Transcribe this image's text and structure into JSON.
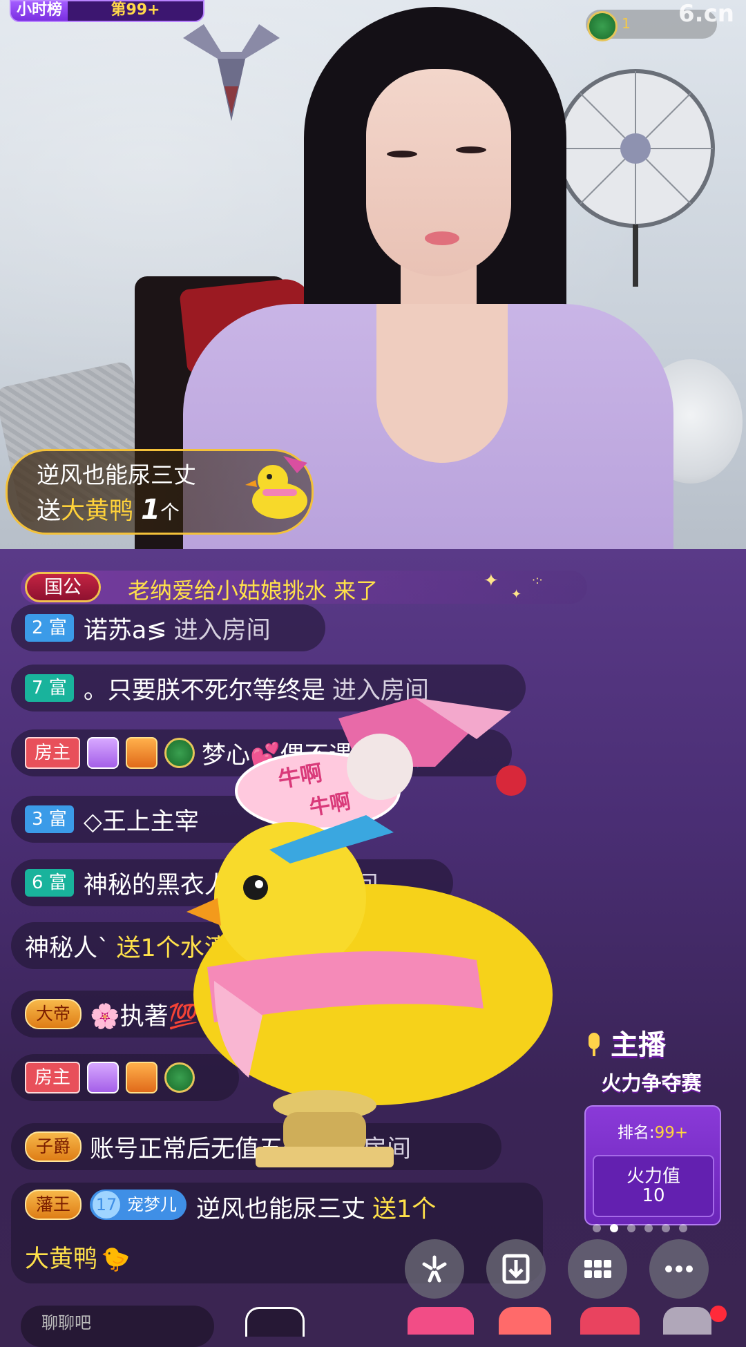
{
  "colors": {
    "accent_gold": "#ffe14a",
    "chat_bg": "#4a2e74",
    "rich_blue": "#3b9be8",
    "rich_teal": "#19b39c",
    "host_red": "#e8505a"
  },
  "top_bar": {
    "rank_label": "小时榜",
    "rank_value": "第99+",
    "level_text": "1",
    "site_logo": "6.cn"
  },
  "gift_popup": {
    "user": "逆风也能尿三丈",
    "action": "送",
    "gift_name": "大黄鸭",
    "count": "1",
    "unit": "个"
  },
  "enter_banner": {
    "badge": "国公",
    "text": "老纳爱给小姑娘挑水 来了"
  },
  "chat": [
    {
      "badge": "2 富",
      "name": "诺苏a≶",
      "action": "进入房间"
    },
    {
      "badge": "7 富",
      "name": "。只要朕不死尔等终是",
      "action": "进入房间"
    },
    {
      "badge": "房主",
      "name": "梦心💕偶不遇见:",
      "action": ""
    },
    {
      "badge": "3 富",
      "name": "◇王上主宰",
      "action": "进入房间"
    },
    {
      "badge": "6 富",
      "name": "神秘的黑衣人555",
      "action": "进入房间"
    },
    {
      "badge": "",
      "name": "神秘人`",
      "action": "送1个水滴"
    },
    {
      "badge": "大帝",
      "name": "🌸执著💯",
      "action": ""
    },
    {
      "badge": "房主",
      "name": "",
      "action": ""
    },
    {
      "badge": "子爵",
      "name": "账号正常后无值五千",
      "action": "进入房间"
    },
    {
      "badge": "藩王",
      "pet": "宠梦儿",
      "pet_level": "17",
      "name": "逆风也能尿三丈",
      "action": "送1个",
      "gift": "大黄鸭"
    }
  ],
  "speech_bubble": "牛啊 牛啊",
  "anchor_widget": {
    "title_line1": "主播",
    "title_line2": "火力争夺赛",
    "rank_label": "排名:",
    "rank_value": "99+",
    "fire_label": "火力值",
    "fire_value": "10"
  },
  "toolbar": {
    "share_icon": "share-icon",
    "download_icon": "download-icon",
    "grid_icon": "grid-icon",
    "more_icon": "more-icon"
  },
  "input_placeholder": "聊聊吧"
}
